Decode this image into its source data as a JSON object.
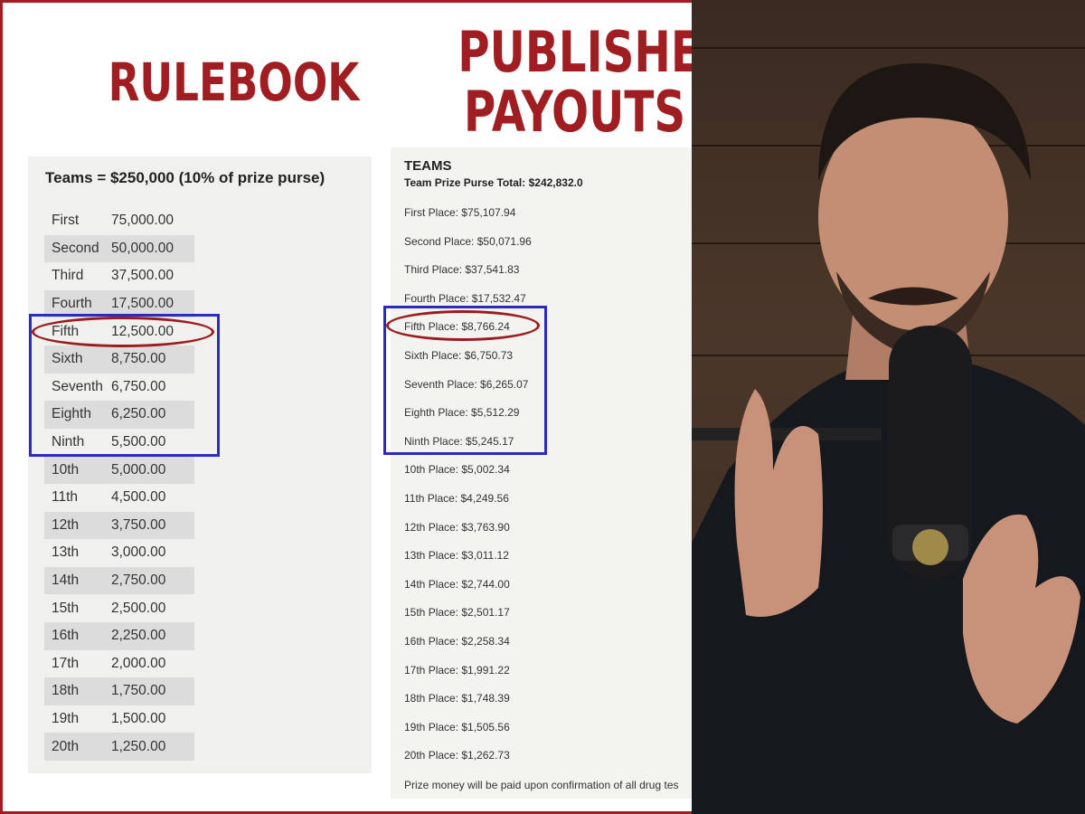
{
  "headlines": {
    "rulebook": "RULEBOOK",
    "published_line1": "PUBLISHED",
    "published_line2": "PAYOUTS"
  },
  "rulebook": {
    "title": "Teams = $250,000 (10% of prize purse)",
    "rows": [
      {
        "place": "First",
        "amount": "75,000.00"
      },
      {
        "place": "Second",
        "amount": "50,000.00"
      },
      {
        "place": "Third",
        "amount": "37,500.00"
      },
      {
        "place": "Fourth",
        "amount": "17,500.00"
      },
      {
        "place": "Fifth",
        "amount": "12,500.00"
      },
      {
        "place": "Sixth",
        "amount": "8,750.00"
      },
      {
        "place": "Seventh",
        "amount": "6,750.00"
      },
      {
        "place": "Eighth",
        "amount": "6,250.00"
      },
      {
        "place": "Ninth",
        "amount": "5,500.00"
      },
      {
        "place": "10th",
        "amount": "5,000.00"
      },
      {
        "place": "11th",
        "amount": "4,500.00"
      },
      {
        "place": "12th",
        "amount": "3,750.00"
      },
      {
        "place": "13th",
        "amount": "3,000.00"
      },
      {
        "place": "14th",
        "amount": "2,750.00"
      },
      {
        "place": "15th",
        "amount": "2,500.00"
      },
      {
        "place": "16th",
        "amount": "2,250.00"
      },
      {
        "place": "17th",
        "amount": "2,000.00"
      },
      {
        "place": "18th",
        "amount": "1,750.00"
      },
      {
        "place": "19th",
        "amount": "1,500.00"
      },
      {
        "place": "20th",
        "amount": "1,250.00"
      }
    ]
  },
  "published": {
    "title": "TEAMS",
    "total": "Team Prize Purse Total: $242,832.0",
    "rows": [
      "First Place: $75,107.94",
      "Second Place: $50,071.96",
      "Third Place: $37,541.83",
      "Fourth Place: $17,532.47",
      "Fifth Place: $8,766.24",
      "Sixth Place: $6,750.73",
      "Seventh Place: $6,265.07",
      "Eighth Place: $5,512.29",
      "Ninth Place: $5,245.17",
      "10th Place: $5,002.34",
      "11th Place: $4,249.56",
      "12th Place: $3,763.90",
      "13th Place: $3,011.12",
      "14th Place: $2,744.00",
      "15th Place: $2,501.17",
      "16th Place: $2,258.34",
      "17th Place: $1,991.22",
      "18th Place: $1,748.39",
      "19th Place: $1,505.56",
      "20th Place: $1,262.73"
    ],
    "note": "Prize money will be paid upon confirmation of all drug tes"
  },
  "colors": {
    "headline_red": "#a01e22",
    "highlight_blue": "#2b2bbd",
    "circle_red": "#9c1b1f"
  }
}
